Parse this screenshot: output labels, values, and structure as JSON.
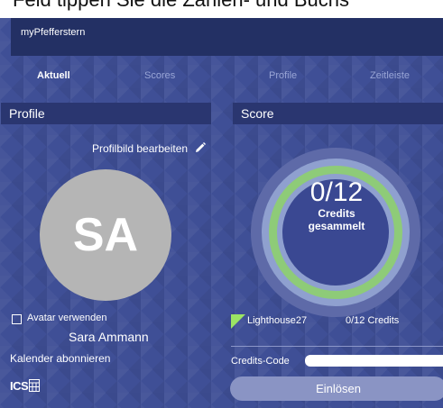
{
  "caption": "Feld tippen Sie die Zahlen- und Buchs",
  "app": {
    "title": "myPfefferstern"
  },
  "tabs": [
    {
      "label": "Aktuell",
      "active": true
    },
    {
      "label": "Scores",
      "active": false
    },
    {
      "label": "Profile",
      "active": false
    },
    {
      "label": "Zeitleiste",
      "active": false
    }
  ],
  "profile": {
    "header": "Profile",
    "edit_label": "Profilbild bearbeiten",
    "initials": "SA",
    "avatar_checkbox_label": "Avatar verwenden",
    "avatar_checked": false,
    "name": "Sara Ammann",
    "calendar_label": "Kalender abonnieren",
    "calendar_icon_text": "ICS"
  },
  "score": {
    "header": "Score",
    "value": "0/12",
    "caption_line1": "Credits",
    "caption_line2": "gesammelt",
    "entry_name": "Lighthouse27",
    "entry_credits": "0/12 Credits",
    "code_label": "Credits-Code",
    "code_value": "",
    "redeem_label": "Einlösen"
  },
  "colors": {
    "background": "#3f4f96",
    "titlebar": "#233064",
    "ring": "#8ecb78",
    "avatar": "#b5b5b5",
    "flag": "#9be564",
    "button": "#8a94c4"
  }
}
